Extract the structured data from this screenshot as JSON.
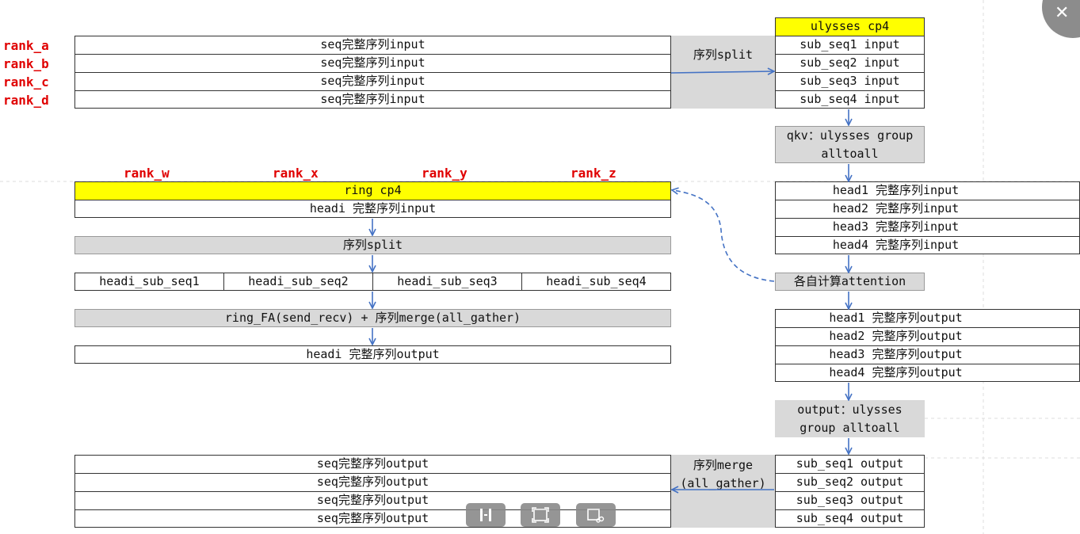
{
  "ranks_left": [
    "rank_a",
    "rank_b",
    "rank_c",
    "rank_d"
  ],
  "seq_input_rows": [
    "seq完整序列input",
    "seq完整序列input",
    "seq完整序列input",
    "seq完整序列input"
  ],
  "split_label": "序列split",
  "ulysses": {
    "title": "ulysses cp4",
    "sub_inputs": [
      "sub_seq1 input",
      "sub_seq2 input",
      "sub_seq3 input",
      "sub_seq4 input"
    ],
    "qkv_label": "qkv：ulysses group alltoall",
    "head_inputs": [
      "head1 完整序列input",
      "head2 完整序列input",
      "head3 完整序列input",
      "head4 完整序列input"
    ],
    "attention_label": "各自计算attention",
    "head_outputs": [
      "head1 完整序列output",
      "head2 完整序列output",
      "head3 完整序列output",
      "head4 完整序列output"
    ],
    "output_label": "output：ulysses group alltoall",
    "sub_outputs": [
      "sub_seq1 output",
      "sub_seq2 output",
      "sub_seq3 output",
      "sub_seq4 output"
    ]
  },
  "ring": {
    "ranks": [
      "rank_w",
      "rank_x",
      "rank_y",
      "rank_z"
    ],
    "title": "ring cp4",
    "headi_input": "headi 完整序列input",
    "split": "序列split",
    "sub_seqs": [
      "headi_sub_seq1",
      "headi_sub_seq2",
      "headi_sub_seq3",
      "headi_sub_seq4"
    ],
    "ring_fa": "ring_FA(send_recv) + 序列merge(all_gather)",
    "headi_output": "headi 完整序列output"
  },
  "merge_label": "序列merge (all_gather)",
  "seq_output_rows": [
    "seq完整序列output",
    "seq完整序列output",
    "seq完整序列output",
    "seq完整序列output"
  ],
  "ui": {
    "close_glyph": "✕",
    "toolbar_icons": [
      "pause-icon",
      "fit-screen-icon",
      "crop-edit-icon"
    ]
  },
  "colors": {
    "highlight": "#ffff00",
    "panel": "#d9d9d9",
    "arrow": "#4472c4",
    "rank_label": "#e00000"
  }
}
